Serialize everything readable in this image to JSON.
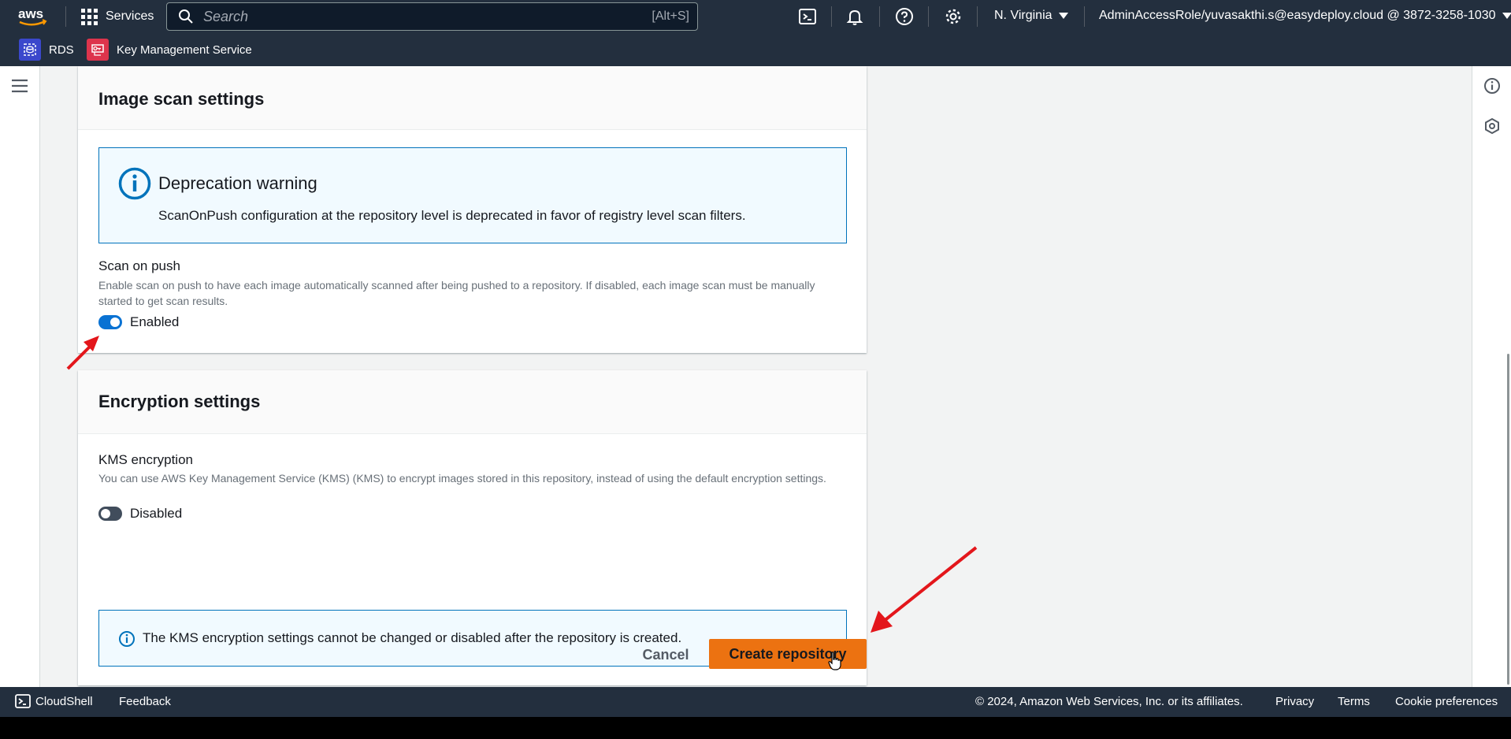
{
  "nav": {
    "services_label": "Services",
    "search_placeholder": "Search",
    "search_shortcut": "[Alt+S]",
    "region": "N. Virginia",
    "account": "AdminAccessRole/yuvasakthi.s@easydeploy.cloud @ 3872-3258-1030"
  },
  "favorites": [
    {
      "label": "RDS",
      "icon": "rds-icon",
      "color": "#3b48cc"
    },
    {
      "label": "Key Management Service",
      "icon": "kms-icon",
      "color": "#dd344c"
    }
  ],
  "image_scan": {
    "title": "Image scan settings",
    "warning_title": "Deprecation warning",
    "warning_text": "ScanOnPush configuration at the repository level is deprecated in favor of registry level scan filters.",
    "scan_label": "Scan on push",
    "scan_desc": "Enable scan on push to have each image automatically scanned after being pushed to a repository. If disabled, each image scan must be manually started to get scan results.",
    "toggle_label": "Enabled",
    "toggle_on": true
  },
  "encryption": {
    "title": "Encryption settings",
    "kms_label": "KMS encryption",
    "kms_desc": "You can use AWS Key Management Service (KMS) (KMS) to encrypt images stored in this repository, instead of using the default encryption settings.",
    "toggle_label": "Disabled",
    "toggle_on": false,
    "info_text": "The KMS encryption settings cannot be changed or disabled after the repository is created."
  },
  "actions": {
    "cancel": "Cancel",
    "create": "Create repository"
  },
  "footer": {
    "cloudshell": "CloudShell",
    "feedback": "Feedback",
    "copyright": "© 2024, Amazon Web Services, Inc. or its affiliates.",
    "privacy": "Privacy",
    "terms": "Terms",
    "cookies": "Cookie preferences"
  },
  "colors": {
    "nav_bg": "#232f3e",
    "primary_button": "#ec7211",
    "toggle_on": "#0972d3",
    "toggle_off": "#414d5c",
    "info_border": "#0073bb",
    "annotation_arrow": "#e3161b"
  }
}
